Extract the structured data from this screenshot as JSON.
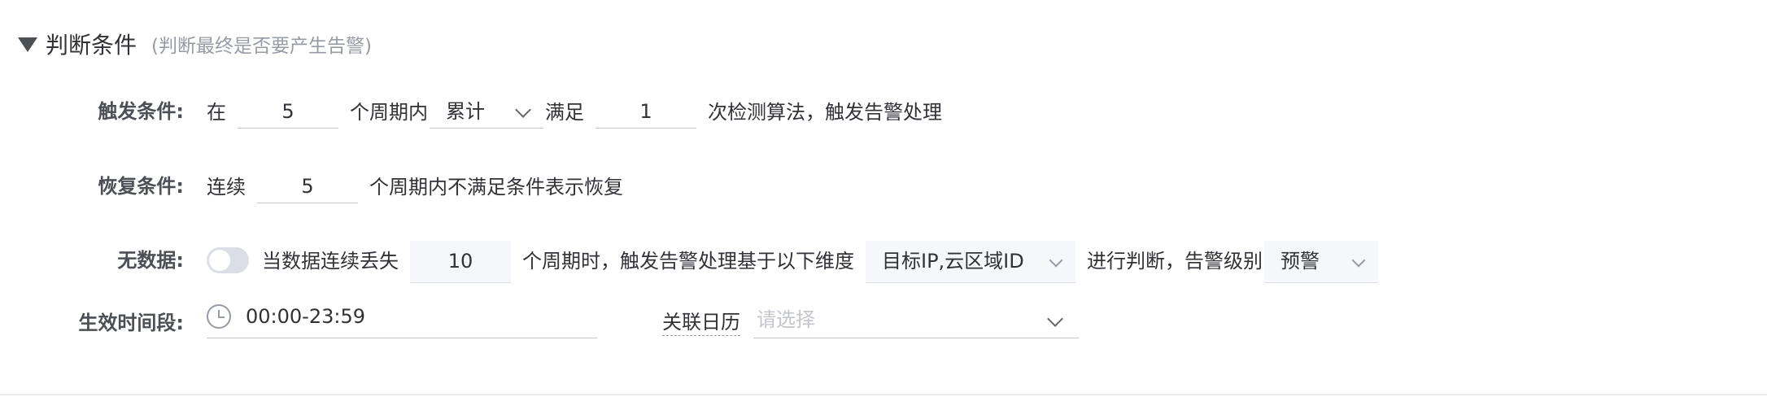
{
  "section": {
    "title": "判断条件",
    "subtitle": "(判断最终是否要产生告警)"
  },
  "trigger": {
    "label": "触发条件:",
    "prefix": "在",
    "periods": "5",
    "mid": "个周期内",
    "method": "累计",
    "satisfy": "满足",
    "count": "1",
    "suffix": "次检测算法，触发告警处理"
  },
  "recovery": {
    "label": "恢复条件:",
    "prefix": "连续",
    "periods": "5",
    "suffix": "个周期内不满足条件表示恢复"
  },
  "nodata": {
    "label": "无数据:",
    "enabled": false,
    "prefix": "当数据连续丢失",
    "periods": "10",
    "mid": "个周期时，触发告警处理基于以下维度",
    "dimension": "目标IP,云区域ID",
    "judge": "进行判断，告警级别",
    "level": "预警"
  },
  "effective": {
    "label": "生效时间段:",
    "time_range": "00:00-23:59",
    "calendar_label": "关联日历",
    "calendar_placeholder": "请选择"
  },
  "colors": {
    "text": "#313238",
    "label": "#4d4f56",
    "muted": "#979ba5",
    "border": "#c4c6cc",
    "input_bg": "#f5f7fa"
  },
  "icons": {
    "collapse": "caret-down-icon",
    "clock": "clock-icon",
    "select": "chevron-down-icon"
  }
}
